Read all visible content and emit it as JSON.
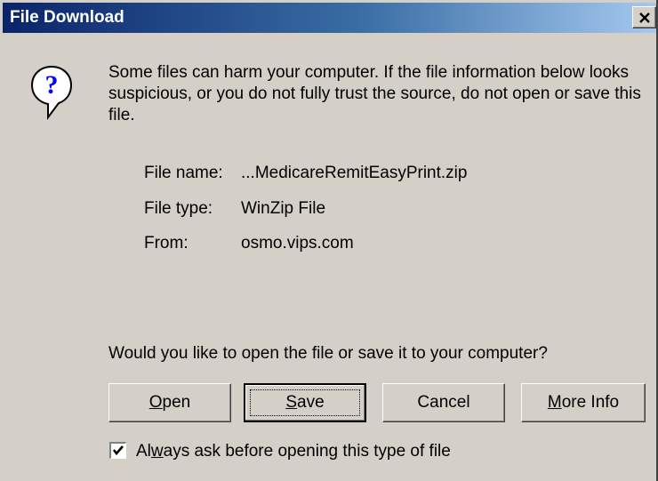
{
  "window": {
    "title": "File Download",
    "close_glyph": "✕"
  },
  "warning": {
    "icon": "help-question-icon",
    "text": "Some files can harm your computer. If the file information below looks suspicious, or you do not fully trust the source, do not open or save this file."
  },
  "file_info": {
    "name_label": "File name:",
    "name_value": "...MedicareRemitEasyPrint.zip",
    "type_label": "File type:",
    "type_value": "WinZip File",
    "from_label": "From:",
    "from_value": "osmo.vips.com"
  },
  "prompt": "Would you like to open the file or save it to your computer?",
  "buttons": {
    "open": {
      "mnemonic": "O",
      "rest": "pen"
    },
    "save": {
      "mnemonic": "S",
      "rest": "ave"
    },
    "cancel": "Cancel",
    "more_info": {
      "mnemonic": "M",
      "rest": "ore Info"
    }
  },
  "checkbox": {
    "checked": true,
    "label_before": "Al",
    "mnemonic": "w",
    "label_after": "ays ask before opening this type of file"
  }
}
